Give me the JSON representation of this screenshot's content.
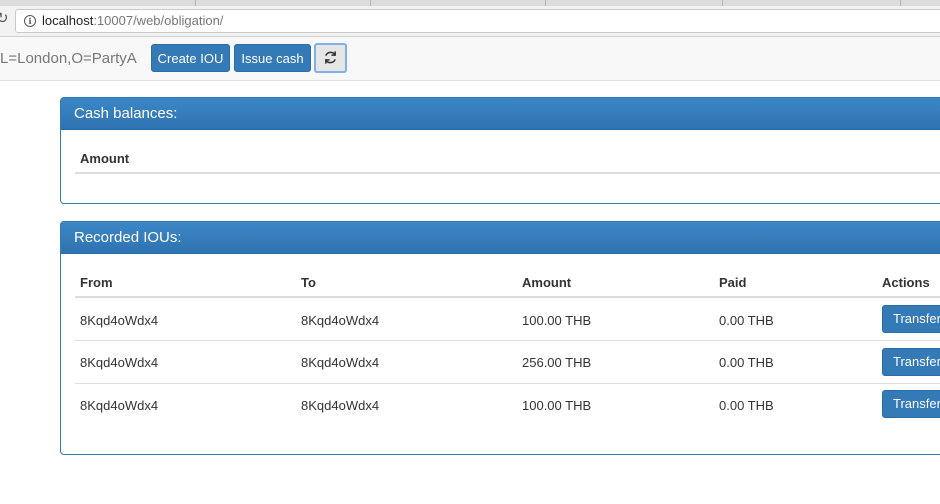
{
  "browser": {
    "url_host": "localhost",
    "url_rest": ":10007/web/obligation/"
  },
  "header": {
    "party": "L=London,O=PartyA",
    "create_label": "Create IOU",
    "issue_label": "Issue cash",
    "refresh_icon": "refresh-icon"
  },
  "cash": {
    "title": "Cash balances:",
    "columns": [
      "Amount"
    ]
  },
  "ious": {
    "title": "Recorded IOUs:",
    "columns": [
      "From",
      "To",
      "Amount",
      "Paid",
      "Actions"
    ],
    "rows": [
      {
        "from": "8Kqd4oWdx4",
        "to": "8Kqd4oWdx4",
        "amount": "100.00 THB",
        "paid": "0.00 THB",
        "action": "Transfer"
      },
      {
        "from": "8Kqd4oWdx4",
        "to": "8Kqd4oWdx4",
        "amount": "256.00 THB",
        "paid": "0.00 THB",
        "action": "Transfer"
      },
      {
        "from": "8Kqd4oWdx4",
        "to": "8Kqd4oWdx4",
        "amount": "100.00 THB",
        "paid": "0.00 THB",
        "action": "Transfer"
      }
    ]
  },
  "colors": {
    "primary": "#337ab7",
    "panel_heading": "#2f73b0"
  }
}
